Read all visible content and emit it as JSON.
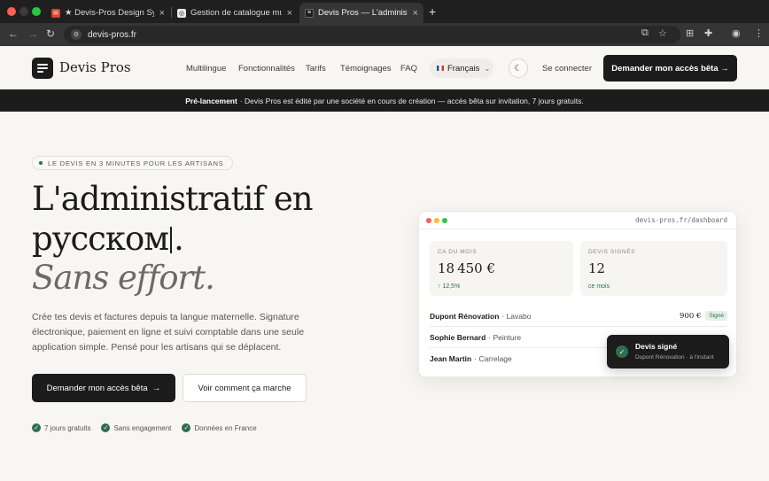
{
  "browser": {
    "tabs": [
      {
        "label": "★ Devis-Pros Design System",
        "icon": "gmail-favicon"
      },
      {
        "label": "Gestion de catalogue multilingue",
        "icon": "openai-favicon"
      },
      {
        "label": "Devis Pros — L'administratif",
        "icon": "devis-pros-favicon"
      }
    ],
    "close_glyph": "×",
    "new_tab_glyph": "+",
    "url": "devis-pros.fr"
  },
  "header": {
    "brand": "Devis Pros",
    "nav": [
      "Multilingue",
      "Fonctionnalités",
      "Tarifs",
      "Témoignages",
      "FAQ"
    ],
    "language": "Français",
    "login": "Se connecter",
    "cta": "Demander mon accès bêta →"
  },
  "announcement": {
    "bold": "Pré-lancement",
    "text": "· Devis Pros est édité par une société en cours de création — accès bêta sur invitation, 7 jours gratuits."
  },
  "hero": {
    "eyebrow": "LE DEVIS EN 3 MINUTES POUR LES ARTISANS",
    "title_line1": "L'administratif en",
    "title_word": "русском",
    "title_period": ".",
    "title_line3": "Sans effort.",
    "paragraph": "Crée tes devis et factures depuis ta langue maternelle. Signature électronique, paiement en ligne et suivi comptable dans une seule application simple. Pensé pour les artisans qui se déplacent.",
    "primary_cta": "Demander mon accès bêta",
    "primary_arrow": "→",
    "secondary_cta": "Voir comment ça marche",
    "checks": [
      "7 jours gratuits",
      "Sans engagement",
      "Données en France"
    ]
  },
  "dashboard": {
    "url": "devis-pros.fr/dashboard",
    "stats": [
      {
        "label": "CA DU MOIS",
        "value": "18 450 €",
        "sub": "↑ 12,5%"
      },
      {
        "label": "DEVIS SIGNÉS",
        "value": "12",
        "sub": "ce mois"
      }
    ],
    "rows": [
      {
        "client": "Dupont Rénovation",
        "job": "· Lavabo",
        "amount": "900 €",
        "badge": "Signé"
      },
      {
        "client": "Sophie Bernard",
        "job": "· Peinture"
      },
      {
        "client": "Jean Martin",
        "job": "· Carrelage"
      }
    ],
    "toast": {
      "title": "Devis signé",
      "sub": "Dupont Rénovation · à l'instant"
    }
  },
  "colors": {
    "accent_green": "#2f6d4d",
    "ink": "#1c1c1c",
    "background": "#f7f6f3"
  }
}
